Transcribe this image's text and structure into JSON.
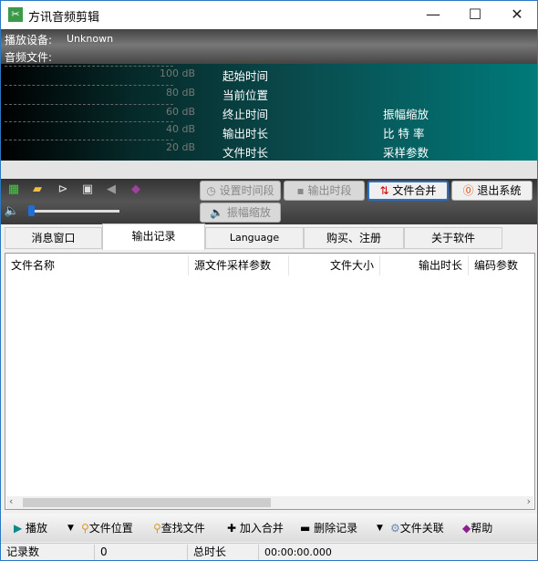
{
  "window": {
    "title": "方讯音频剪辑",
    "app_icon": "scissors-icon",
    "minimize": "—",
    "maximize": "☐",
    "close": "✕"
  },
  "info": {
    "device_label": "播放设备:",
    "device_value": "Unknown",
    "file_label": "音频文件:"
  },
  "meter": {
    "db_levels": [
      "100 dB",
      "80 dB",
      "60 dB",
      "40 dB",
      "20 dB"
    ],
    "left_labels": [
      "起始时间",
      "当前位置",
      "终止时间",
      "输出时长",
      "文件时长"
    ],
    "right_labels": [
      "振幅缩放",
      "比 特 率",
      "采样参数"
    ]
  },
  "toolbar": {
    "icons": [
      "sound-card-icon",
      "folder-open-icon",
      "play-icon",
      "stop-icon",
      "speaker-icon",
      "book-icon"
    ],
    "set_range": "设置时间段",
    "output_range": "输出时段",
    "merge": "文件合并",
    "exit": "退出系统",
    "amplitude": "振幅缩放",
    "volume_percent": 0
  },
  "tabs": [
    {
      "label": "消息窗口"
    },
    {
      "label": "输出记录",
      "selected": true
    },
    {
      "label": "Language"
    },
    {
      "label": "购买、注册"
    },
    {
      "label": "关于软件"
    }
  ],
  "list": {
    "columns": [
      "文件名称",
      "源文件采样参数",
      "文件大小",
      "输出时长",
      "编码参数"
    ],
    "rows": []
  },
  "bottom_toolbar": {
    "play": "播放",
    "file_location": "文件位置",
    "find_file": "查找文件",
    "add_merge": "加入合并",
    "delete_record": "删除记录",
    "file_assoc": "文件关联",
    "help": "帮助"
  },
  "status": {
    "count_label": "记录数",
    "count_value": "0",
    "total_label": "总时长",
    "total_value": "00:00:00.000"
  },
  "colors": {
    "teal": "#007a7a",
    "accent": "#2a6fc8"
  }
}
